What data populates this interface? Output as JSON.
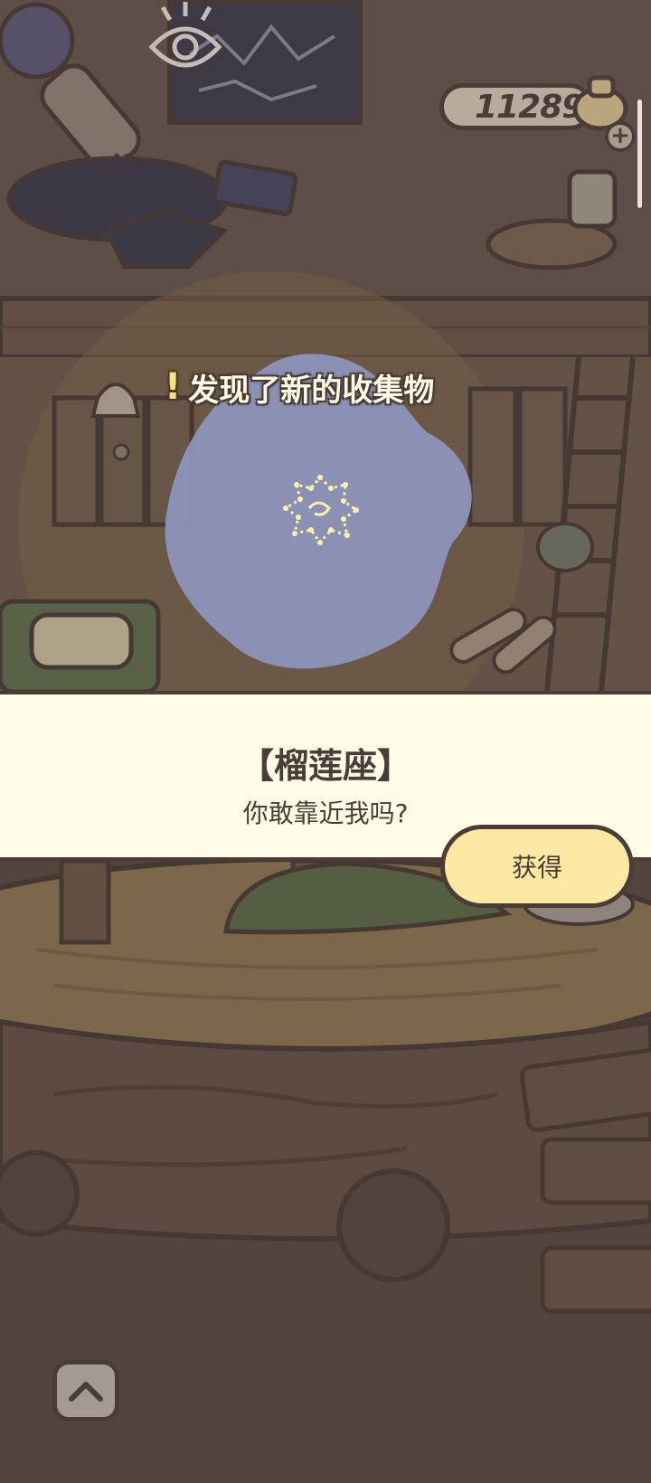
{
  "header": {
    "coin_count": "11289",
    "add_coins_symbol": "+"
  },
  "discovery": {
    "title": "发现了新的收集物",
    "exclamation": "!",
    "star_color": "#fff2a8",
    "blob_color": "#8e95bd"
  },
  "item": {
    "name": "【榴莲座】",
    "description": "你敢靠近我吗?"
  },
  "actions": {
    "get_label": "获得",
    "expand_icon": "chevron-up-icon"
  },
  "colors": {
    "outline": "#4a3c36",
    "banner_bg": "#fffbe6",
    "button_bg": "#fde9a3",
    "scene_dark": "#5d4d47"
  }
}
